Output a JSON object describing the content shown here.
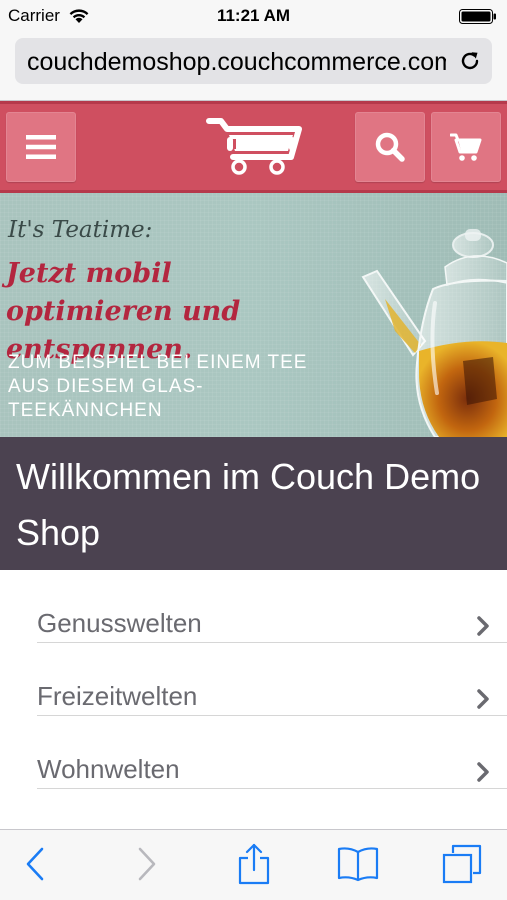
{
  "status_bar": {
    "carrier": "Carrier",
    "time": "11:21 AM"
  },
  "browser": {
    "url": "couchdemoshop.couchcommerce.com"
  },
  "shop": {
    "accent_color": "#cf4f60",
    "welcome_color": "#4b4250"
  },
  "banner": {
    "teatime": "It's Teatime:",
    "slogan": "Jetzt mobil optimieren und entspannen.",
    "subline": "ZUM BEISPIEL BEI EINEM TEE AUS DIESEM GLAS-TEEKÄNNCHEN"
  },
  "welcome": {
    "title": "Willkommen im Couch Demo Shop"
  },
  "categories": [
    {
      "label": "Genusswelten"
    },
    {
      "label": "Freizeitwelten"
    },
    {
      "label": "Wohnwelten"
    }
  ],
  "toolbar": {
    "icons": [
      "back-icon",
      "forward-icon",
      "share-icon",
      "bookmarks-icon",
      "tabs-icon"
    ]
  }
}
